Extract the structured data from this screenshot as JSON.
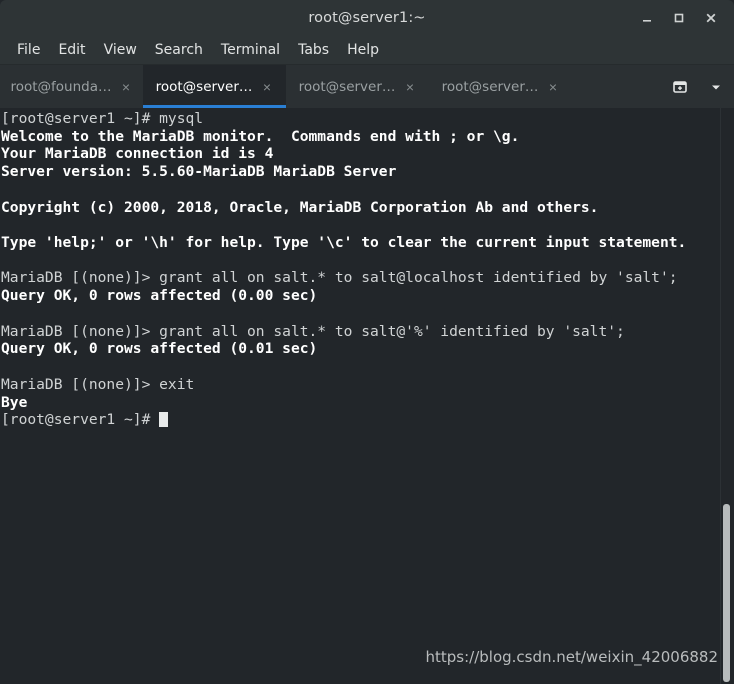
{
  "window": {
    "title": "root@server1:~",
    "controls": [
      {
        "name": "minimize",
        "glyph": "_"
      },
      {
        "name": "maximize",
        "glyph": "□"
      },
      {
        "name": "close",
        "glyph": "×"
      }
    ]
  },
  "menubar": {
    "items": [
      "File",
      "Edit",
      "View",
      "Search",
      "Terminal",
      "Tabs",
      "Help"
    ]
  },
  "tabbar": {
    "tabs": [
      {
        "label": "root@founda…",
        "active": false,
        "close": "×"
      },
      {
        "label": "root@server…",
        "active": true,
        "close": "×"
      },
      {
        "label": "root@server…",
        "active": false,
        "close": "×"
      },
      {
        "label": "root@server…",
        "active": false,
        "close": "×"
      }
    ],
    "new_tab_icon": "new-tab-icon",
    "tab_list_icon": "chevron-down-icon"
  },
  "terminal": {
    "lines": [
      {
        "text": "[root@server1 ~]# mysql",
        "bold": false
      },
      {
        "text": "Welcome to the MariaDB monitor.  Commands end with ; or \\g.",
        "bold": true
      },
      {
        "text": "Your MariaDB connection id is 4",
        "bold": true
      },
      {
        "text": "Server version: 5.5.60-MariaDB MariaDB Server",
        "bold": true
      },
      {
        "text": "",
        "bold": false
      },
      {
        "text": "Copyright (c) 2000, 2018, Oracle, MariaDB Corporation Ab and others.",
        "bold": true
      },
      {
        "text": "",
        "bold": false
      },
      {
        "text": "Type 'help;' or '\\h' for help. Type '\\c' to clear the current input statement.",
        "bold": true
      },
      {
        "text": "",
        "bold": false
      },
      {
        "text": "MariaDB [(none)]> grant all on salt.* to salt@localhost identified by 'salt';",
        "bold": false
      },
      {
        "text": "Query OK, 0 rows affected (0.00 sec)",
        "bold": true
      },
      {
        "text": "",
        "bold": false
      },
      {
        "text": "MariaDB [(none)]> grant all on salt.* to salt@'%' identified by 'salt';",
        "bold": false
      },
      {
        "text": "Query OK, 0 rows affected (0.01 sec)",
        "bold": true
      },
      {
        "text": "",
        "bold": false
      },
      {
        "text": "MariaDB [(none)]> exit",
        "bold": false
      },
      {
        "text": "Bye",
        "bold": true
      }
    ],
    "prompt": "[root@server1 ~]# ",
    "cursor": "block-cursor"
  },
  "watermark": {
    "text": "https://blog.csdn.net/weixin_42006882"
  },
  "colors": {
    "titlebar_bg": "#2e3436",
    "tabbar_bg": "#2b3033",
    "terminal_bg": "#22262a",
    "active_tab_underline": "#2a7fd4",
    "text": "#d0d3d4",
    "bold_text": "#ffffff"
  }
}
